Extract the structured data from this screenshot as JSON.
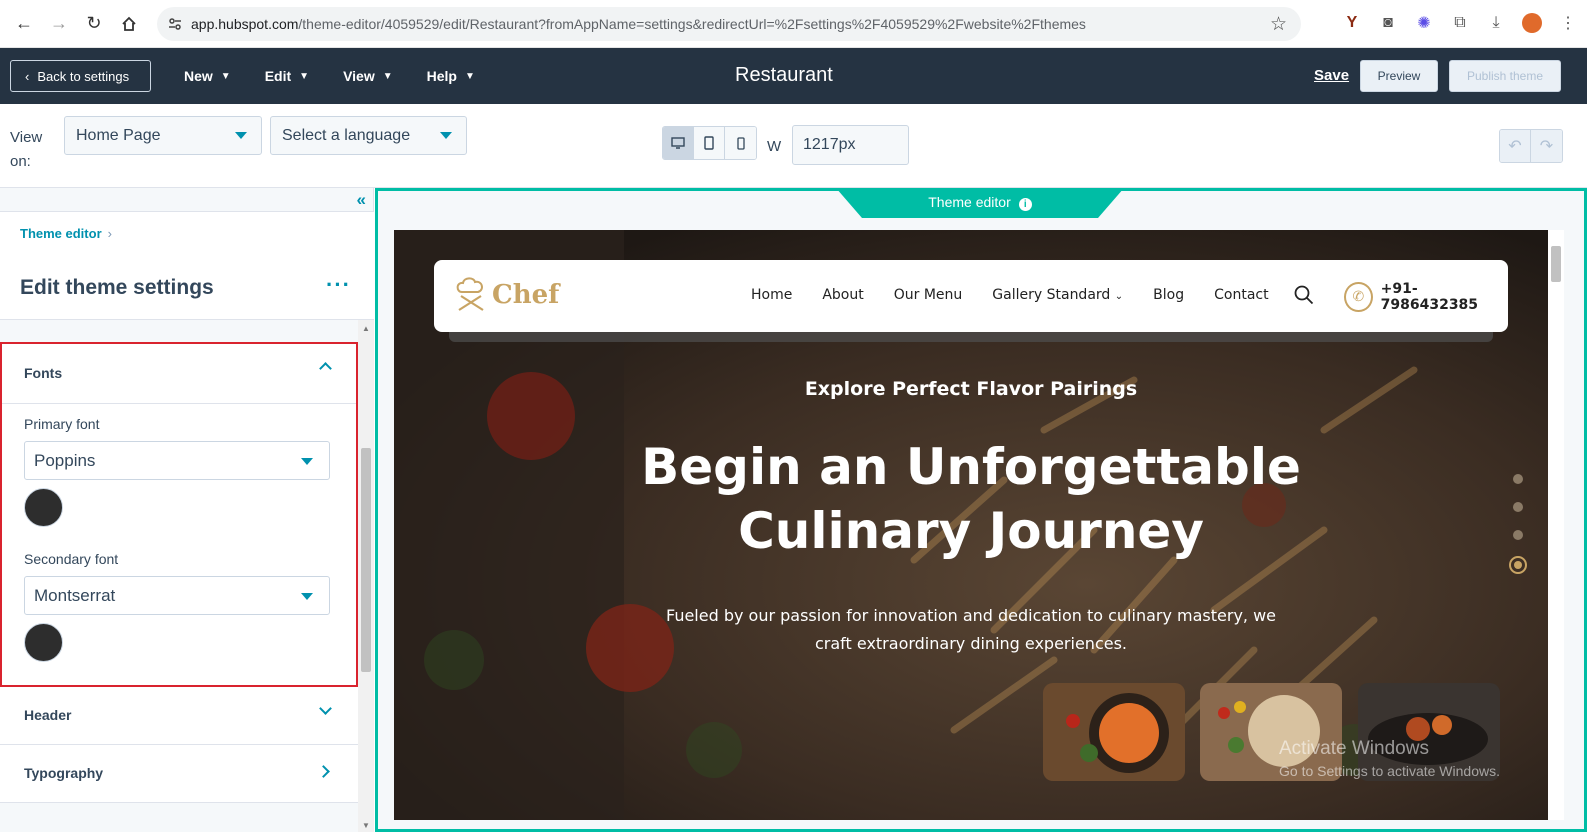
{
  "browser": {
    "url_host": "app.hubspot.com",
    "url_path": "/theme-editor/4059529/edit/Restaurant?fromAppName=settings&redirectUrl=%2Fsettings%2F4059529%2Fwebsite%2Fthemes"
  },
  "topbar": {
    "back_label": "Back to settings",
    "menus": [
      "New",
      "Edit",
      "View",
      "Help"
    ],
    "title": "Restaurant",
    "save_label": "Save",
    "preview_label": "Preview",
    "publish_label": "Publish theme"
  },
  "toolbar": {
    "view_on_label": "View on:",
    "page_select": "Home Page",
    "language_select": "Select a language",
    "width_label": "W",
    "width_value": "1217px",
    "active_device": "desktop"
  },
  "sidebar": {
    "breadcrumb": "Theme editor",
    "title": "Edit theme settings",
    "fonts_section": {
      "label": "Fonts",
      "primary_label": "Primary font",
      "primary_value": "Poppins",
      "primary_color": "#2d2d2d",
      "secondary_label": "Secondary font",
      "secondary_value": "Montserrat",
      "secondary_color": "#2d2d2d"
    },
    "collapsed_sections": [
      "Header",
      "Typography"
    ]
  },
  "preview": {
    "tab_label": "Theme editor",
    "accent_color": "#00bda5",
    "site": {
      "logo_text": "Chef",
      "nav": [
        "Home",
        "About",
        "Our Menu",
        "Gallery Standard",
        "Blog",
        "Contact"
      ],
      "phone": "+91-7986432385",
      "kicker": "Explore Perfect Flavor Pairings",
      "title_line1": "Begin an Unforgettable",
      "title_line2": "Culinary Journey",
      "subtitle": "Fueled by our passion for innovation and dedication to culinary mastery, we craft extraordinary dining experiences."
    }
  },
  "os_watermark": {
    "line1": "Activate Windows",
    "line2": "Go to Settings to activate Windows."
  }
}
